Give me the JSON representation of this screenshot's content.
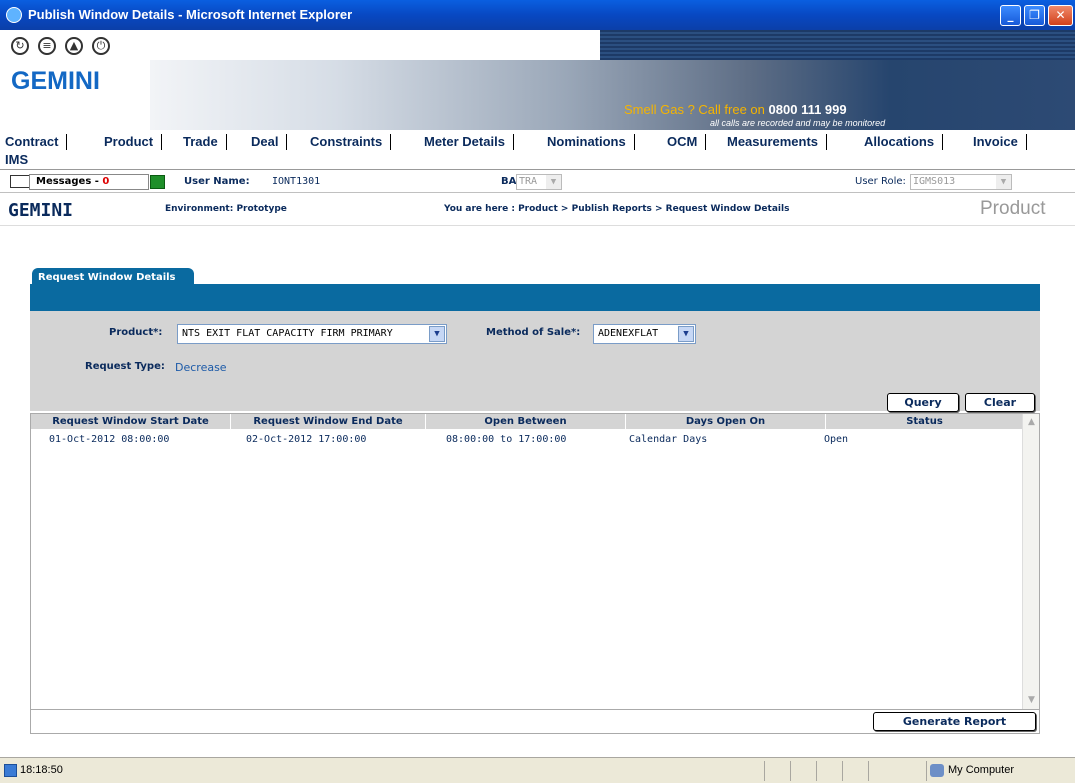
{
  "window": {
    "title": "Publish Window Details - Microsoft Internet Explorer"
  },
  "banner": {
    "logo": "GEMINI",
    "promo_main": "Smell Gas ? Call free on",
    "promo_number": "0800 111 999",
    "promo_sub": "all calls are recorded and may be monitored"
  },
  "nav": {
    "items": [
      "Contract",
      "Product",
      "Trade",
      "Deal",
      "Constraints",
      "Meter Details",
      "Nominations",
      "OCM",
      "Measurements",
      "Allocations",
      "Invoice",
      "IMS"
    ]
  },
  "infobar": {
    "messages_label": "Messages - ",
    "messages_count": "0",
    "username_label": "User Name:",
    "username_value": "IONT1301",
    "ba_label": "BA:",
    "ba_value": "TRA",
    "role_label": "User Role:",
    "role_value": "IGMS013"
  },
  "header": {
    "brand": "GEMINI",
    "environment": "Environment: Prototype",
    "breadcrumb": "You are here : Product > Publish Reports > Request Window Details",
    "section": "Product"
  },
  "form": {
    "tab_label": "Request Window Details",
    "product_label": "Product*:",
    "product_value": "NTS EXIT FLAT CAPACITY FIRM PRIMARY",
    "method_label": "Method of Sale*:",
    "method_value": "ADENEXFLAT",
    "request_type_label": "Request Type:",
    "request_type_value": "Decrease",
    "query_label": "Query",
    "clear_label": "Clear"
  },
  "table": {
    "headers": [
      "Request Window Start Date",
      "Request Window End Date",
      "Open Between",
      "Days Open On",
      "Status"
    ],
    "rows": [
      [
        "01-Oct-2012 08:00:00",
        "02-Oct-2012 17:00:00",
        "08:00:00 to 17:00:00",
        "Calendar Days",
        "Open"
      ]
    ],
    "generate_label": "Generate Report"
  },
  "status": {
    "time": "18:18:50",
    "zone": "My Computer"
  }
}
